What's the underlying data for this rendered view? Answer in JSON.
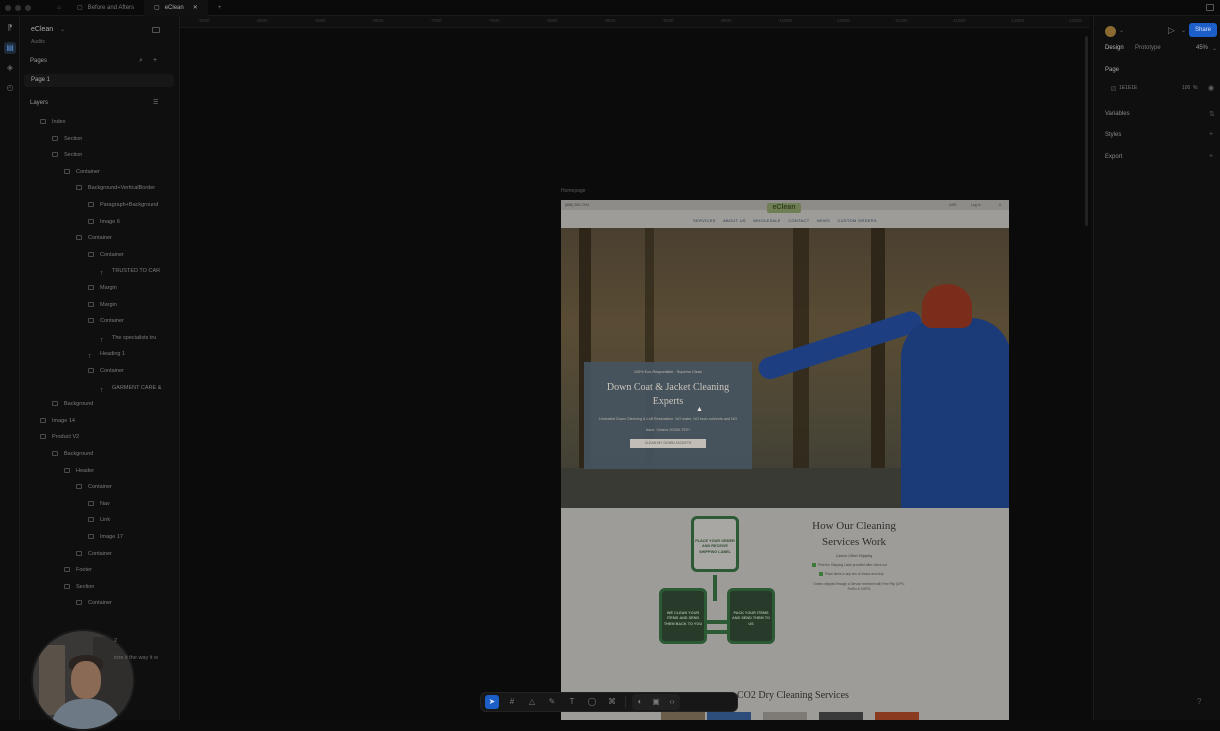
{
  "titlebar": {
    "tabs": [
      {
        "label": "Before and Afters",
        "active": false
      },
      {
        "label": "eClean",
        "active": true
      }
    ]
  },
  "file": {
    "name": "eClean",
    "subtitle": "Audits"
  },
  "layers_panel": {
    "pages_label": "Pages",
    "current_page": "Page 1",
    "layers_label": "Layers",
    "items": [
      {
        "label": "Index"
      },
      {
        "label": "Section"
      },
      {
        "label": "Section"
      },
      {
        "label": "Container"
      },
      {
        "label": "Background+VerticalBorder"
      },
      {
        "label": "Paragraph+Background"
      },
      {
        "label": "Image 6"
      },
      {
        "label": "Container"
      },
      {
        "label": "Container"
      },
      {
        "label": "TRUSTED TO CAR"
      },
      {
        "label": "Margin"
      },
      {
        "label": "Margin"
      },
      {
        "label": "Container"
      },
      {
        "label": "The specialists tru"
      },
      {
        "label": "Heading 1"
      },
      {
        "label": "Container"
      },
      {
        "label": "GARMENT CARE &"
      },
      {
        "label": "Background"
      },
      {
        "label": "Image 14"
      },
      {
        "label": "Product V2"
      },
      {
        "label": "Background"
      },
      {
        "label": "Header"
      },
      {
        "label": "Container"
      },
      {
        "label": "Nav"
      },
      {
        "label": "Link"
      },
      {
        "label": "Image 17"
      },
      {
        "label": "Container"
      },
      {
        "label": "Footer"
      },
      {
        "label": "Section"
      },
      {
        "label": "Container"
      }
    ],
    "partial_text": [
      "2",
      "tore it the way it w"
    ]
  },
  "canvas": {
    "ruler_ticks": [
      "-5000",
      "-5500",
      "-6000",
      "-6500",
      "-7000",
      "-7500",
      "-8000",
      "-8500",
      "-9000",
      "-9500",
      "-10000",
      "-10500",
      "-11000",
      "-11500",
      "-12000",
      "-12500"
    ],
    "frame_label": "Homepage"
  },
  "website": {
    "phone": "(888) 253-7244",
    "logo": "eClean",
    "topbar_right": [
      "USD",
      "Log in",
      "0"
    ],
    "nav": [
      "SERVICES",
      "ABOUT US",
      "WHOLESALE",
      "CONTACT",
      "NEWS",
      "CUSTOM ORDERS"
    ],
    "hero": {
      "kicker": "100% Eco-Responsible · Superior Clean",
      "title": "Down Coat & Jacket Cleaning Experts",
      "body": "Unrivaled Down Cleaning & Loft Restoration. NO water, NO toxic solvents and NO trace. Cleans 00000-TEX*",
      "button": "CLEAN MY DOWN JACKETS"
    },
    "how": {
      "title": "How Our Cleaning Services Work",
      "subtitle": "Carbon Offset Shipping",
      "checks": [
        "Print the Shipping Label provided after check out",
        "Place items in any box of choice and ship",
        "Orders shipped through a Service reviewed with Free Pkp (UPS, FedEx & USPS)"
      ],
      "steps": [
        "PLACE YOUR ORDER AND RECEIVE SHIPPING LABEL",
        "PACK YOUR ITEMS AND SEND THEM TO US",
        "WE CLEAN YOUR ITEMS AND SEND THEM BACK TO YOU"
      ]
    },
    "section2_title": "CO2 Dry Cleaning Services"
  },
  "right_panel": {
    "tabs": [
      "Design",
      "Prototype"
    ],
    "zoom": "45%",
    "share_label": "Share",
    "page_label": "Page",
    "bg_hex": "1E1E1E",
    "bg_opacity": "100",
    "bg_unit": "%",
    "variables_label": "Variables",
    "styles_label": "Styles",
    "export_label": "Export"
  },
  "colors": {
    "accent": "#1d5fc9",
    "canvas_bg": "#0b0b0b",
    "panel_bg": "#0f0f0f"
  }
}
